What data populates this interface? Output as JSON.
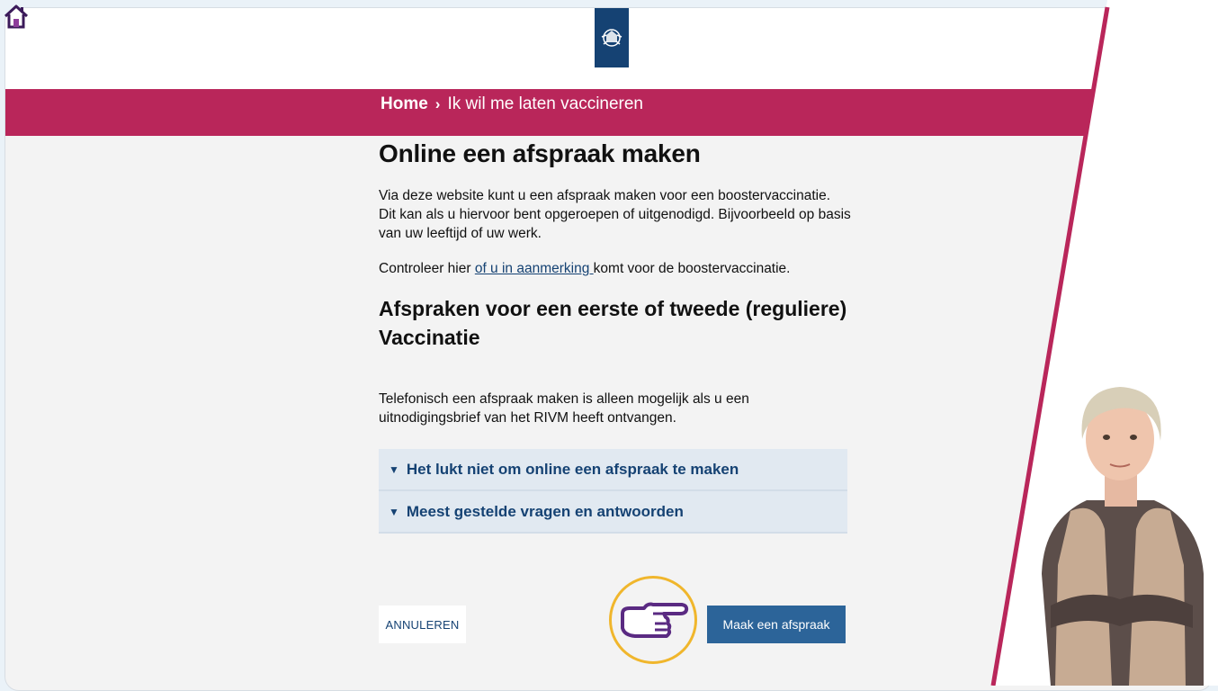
{
  "header": {
    "logo_alt": "Rijksoverheid logo",
    "home_icon": "home-icon"
  },
  "breadcrumb": {
    "home": "Home",
    "separator": "›",
    "current": "Ik wil me laten vaccineren"
  },
  "main": {
    "title": "Online een afspraak maken",
    "intro": "Via deze website kunt u een afspraak maken voor een boostervaccinatie. Dit kan als u hiervoor bent opgeroepen of uitgenodigd. Bijvoorbeeld op basis van uw leeftijd of uw werk.",
    "check_prefix": "Controleer hier ",
    "check_link": "of u in aanmerking ",
    "check_suffix": "komt voor de boostervaccinatie.",
    "subtitle": "Afspraken voor een eerste of tweede (reguliere) Vaccinatie",
    "phone_text": "Telefonisch een afspraak maken is alleen mogelijk als u een uitnodigingsbrief van het RIVM heeft ontvangen.",
    "accordion": [
      {
        "label": "Het lukt niet om online een afspraak te maken"
      },
      {
        "label": "Meest gestelde vragen en antwoorden"
      }
    ]
  },
  "actions": {
    "cancel": "ANNULEREN",
    "primary": "Maak een afspraak"
  },
  "colors": {
    "brand_bar": "#b9265a",
    "link": "#154273",
    "primary_button": "#2c6499",
    "highlight_ring": "#f0b62c"
  }
}
